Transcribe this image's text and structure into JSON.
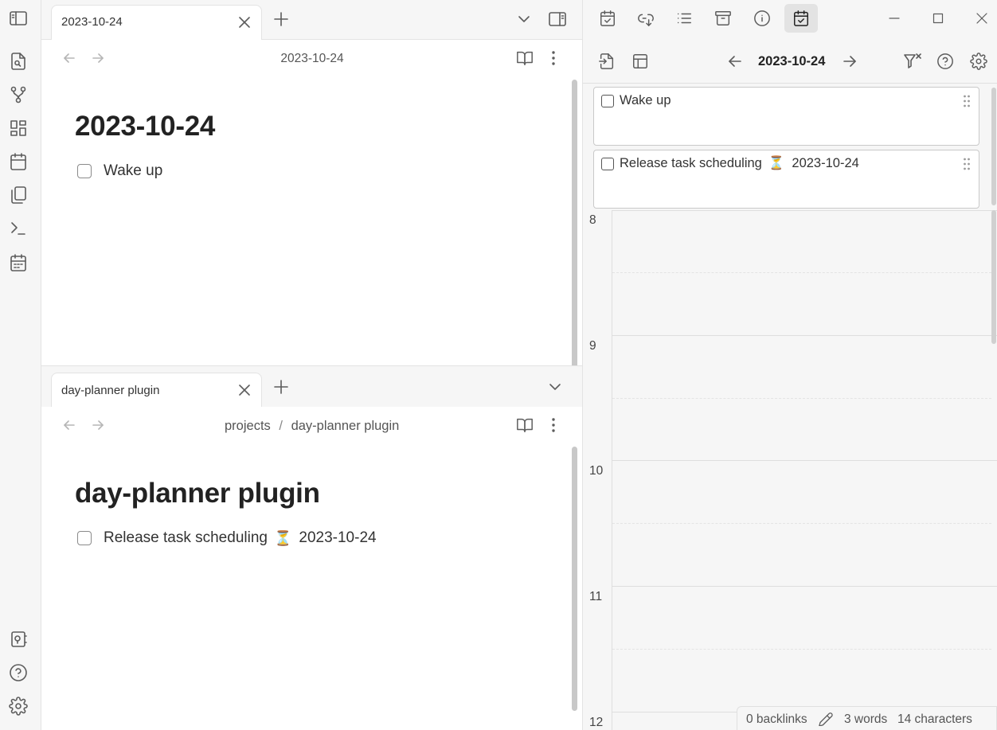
{
  "top_tab": {
    "label": "2023-10-24"
  },
  "top_note": {
    "nav_title": "2023-10-24",
    "heading": "2023-10-24",
    "task": "Wake up"
  },
  "bottom_tab": {
    "label": "day-planner plugin"
  },
  "bottom_note": {
    "breadcrumb_folder": "projects",
    "breadcrumb_sep": "/",
    "breadcrumb_file": "day-planner plugin",
    "heading": "day-planner plugin",
    "task_text": "Release task scheduling",
    "task_icon": "⏳",
    "task_date": "2023-10-24"
  },
  "planner": {
    "date": "2023-10-24",
    "cards": [
      {
        "text": "Wake up"
      },
      {
        "text": "Release task scheduling",
        "icon": "⏳",
        "date": "2023-10-24"
      }
    ],
    "hours": [
      "8",
      "9",
      "10",
      "11",
      "12"
    ]
  },
  "status_bar": {
    "backlinks": "0 backlinks",
    "words": "3 words",
    "characters": "14 characters"
  },
  "icons": {
    "ribbon": [
      "sidebar-toggle-icon",
      "file-search-icon",
      "graph-icon",
      "canvas-icon",
      "calendar-icon",
      "templates-icon",
      "terminal-icon",
      "day-planner-icon",
      "vault-icon",
      "help-icon",
      "settings-icon"
    ],
    "right_header": [
      "daily-tasks-icon",
      "backlinks-icon",
      "outline-icon",
      "archive-icon",
      "info-icon",
      "planner-timeline-icon"
    ]
  },
  "colors": {
    "accent": "#e8e8e8",
    "panel_bg": "#f6f6f6",
    "border": "#e3e3e3"
  }
}
